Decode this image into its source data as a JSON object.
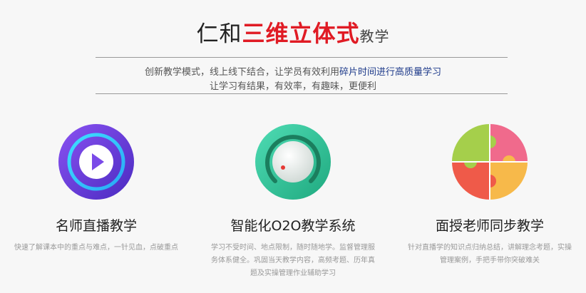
{
  "header": {
    "title_pre": "仁和",
    "title_highlight": "三维立体式",
    "title_post": "教学",
    "subtitle_line1_part1": "创新教学模式，线上线下结合，让学员有效利用",
    "subtitle_line1_highlight": "碎片时间进行高质量学习",
    "subtitle_line2": "让学习有结果，有效率，有趣味，更便利"
  },
  "features": [
    {
      "icon": "play-icon",
      "title": "名师直播教学",
      "desc": "快速了解课本中的重点与难点，一针见血，点破重点"
    },
    {
      "icon": "knob-icon",
      "title": "智能化O2O教学系统",
      "desc": "学习不受时间、地点限制，随时随地学。监督管理服务体系健全。巩固当天教学内容，高频考题、历年真题及实操管理作业辅助学习"
    },
    {
      "icon": "puzzle-icon",
      "title": "面授老师同步教学",
      "desc": "针对直播学的知识点归纳总结，讲解理念考题，实操管理案例，手把手带你突破难关"
    }
  ],
  "colors": {
    "highlight_red": "#e01b24",
    "highlight_blue": "#1d3a8a",
    "purple": "#6d3fe0",
    "green": "#2fc49a"
  }
}
